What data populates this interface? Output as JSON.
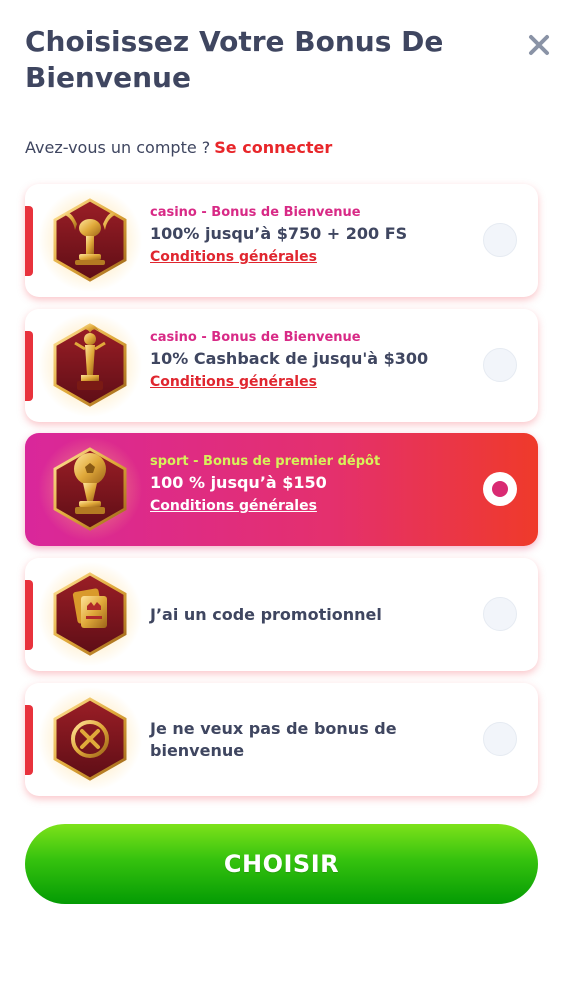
{
  "header": {
    "title": "Choisissez Votre Bonus De Bienvenue",
    "account_question": "Avez-vous un compte ?",
    "login_link": "Se connecter"
  },
  "bonuses": [
    {
      "category": "casino - Bonus de Bienvenue",
      "offer": "100% jusqu’à $750 + 200 FS",
      "terms": "Conditions générales",
      "icon": "winged-lion-trophy-icon",
      "selected": false
    },
    {
      "category": "casino - Bonus de Bienvenue",
      "offer": "10% Cashback de jusqu'à $300",
      "terms": "Conditions générales",
      "icon": "award-statue-icon",
      "selected": false
    },
    {
      "category": "sport - Bonus de premier dépôt",
      "offer": "100 % jusqu’à $150",
      "terms": "Conditions générales",
      "icon": "golden-football-trophy-icon",
      "selected": true
    },
    {
      "offer": "J’ai un code promotionnel",
      "icon": "promo-code-cards-icon",
      "selected": false
    },
    {
      "offer": "Je ne veux pas de bonus de bienvenue",
      "icon": "no-bonus-x-icon",
      "selected": false
    }
  ],
  "cta": {
    "label": "CHOISIR"
  },
  "colors": {
    "accent_red": "#e8323c",
    "category_pink": "#d82a86",
    "selected_category": "#d7f25a",
    "cta_green": "#35c20e"
  }
}
